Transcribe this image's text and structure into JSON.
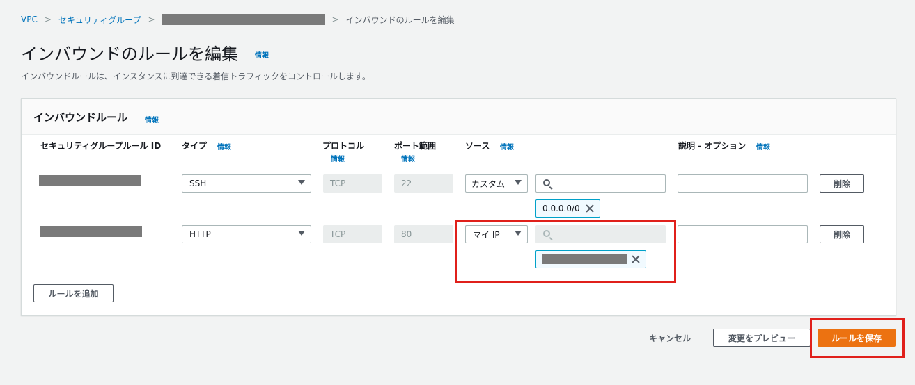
{
  "breadcrumb": {
    "vpc": "VPC",
    "security_groups": "セキュリティグループ",
    "current": "インバウンドのルールを編集"
  },
  "page": {
    "title": "インバウンドのルールを編集",
    "info": "情報",
    "description": "インバウンドルールは、インスタンスに到達できる着信トラフィックをコントロールします。"
  },
  "panel": {
    "title": "インバウンドルール",
    "info": "情報"
  },
  "columns": {
    "rule_id": "セキュリティグループルール ID",
    "type": "タイプ",
    "type_info": "情報",
    "protocol": "プロトコル",
    "protocol_info": "情報",
    "port_range": "ポート範囲",
    "port_info": "情報",
    "source": "ソース",
    "source_info": "情報",
    "description": "説明 - オプション",
    "description_info": "情報"
  },
  "rules": [
    {
      "type": "SSH",
      "protocol": "TCP",
      "port": "22",
      "source_type": "カスタム",
      "source_token": "0.0.0.0/0",
      "delete_label": "削除"
    },
    {
      "type": "HTTP",
      "protocol": "TCP",
      "port": "80",
      "source_type": "マイ IP",
      "source_token": "",
      "delete_label": "削除"
    }
  ],
  "add_rule_label": "ルールを追加",
  "footer": {
    "cancel": "キャンセル",
    "preview": "変更をプレビュー",
    "save": "ルールを保存"
  },
  "colors": {
    "link": "#0073bb",
    "primary": "#ec7211",
    "highlight": "#e0201b"
  }
}
